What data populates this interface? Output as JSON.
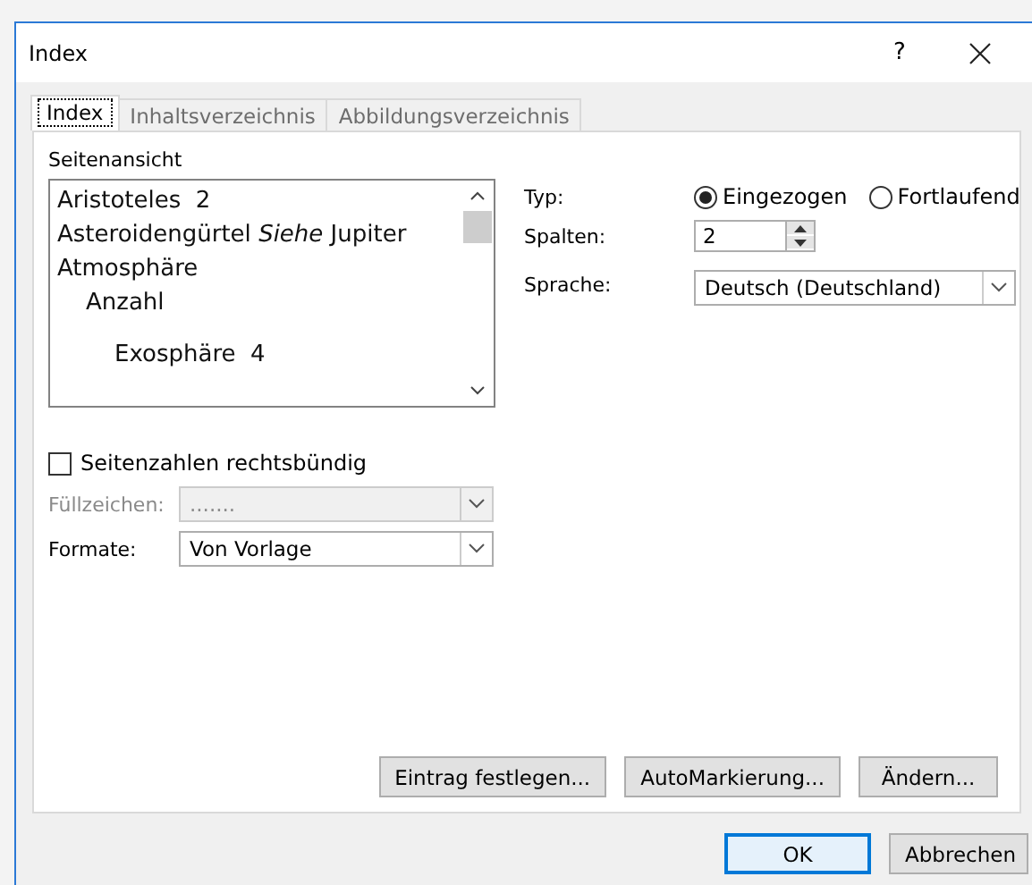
{
  "window": {
    "title": "Index",
    "help_button": "?"
  },
  "tabs": [
    {
      "label": "Index",
      "selected": true
    },
    {
      "label": "Inhaltsverzeichnis",
      "selected": false
    },
    {
      "label": "Abbildungsverzeichnis",
      "selected": false
    }
  ],
  "preview": {
    "label": "Seitenansicht",
    "entries": [
      {
        "text": "Aristoteles  2"
      },
      {
        "text": "Asteroidengürtel *Siehe* Jupiter"
      },
      {
        "text": "Atmosphäre",
        "children": [
          {
            "text": "Anzahl",
            "children": [
              {
                "text": "Exosphäre  4"
              }
            ]
          }
        ]
      }
    ]
  },
  "type": {
    "label": "Typ:",
    "options": [
      {
        "label": "Eingezogen",
        "selected": true
      },
      {
        "label": "Fortlaufend",
        "selected": false
      }
    ]
  },
  "columns": {
    "label": "Spalten:",
    "value": "2"
  },
  "language": {
    "label": "Sprache:",
    "value": "Deutsch (Deutschland)"
  },
  "right_align": {
    "label": "Seitenzahlen rechtsbündig",
    "checked": false
  },
  "leader": {
    "label": "Füllzeichen:",
    "value": ".......",
    "disabled": true
  },
  "formats": {
    "label": "Formate:",
    "value": "Von Vorlage",
    "disabled": false
  },
  "actions": [
    "Eintrag festlegen...",
    "AutoMarkierung...",
    "Ändern..."
  ],
  "buttons": [
    {
      "label": "OK",
      "default": true
    },
    {
      "label": "Abbrechen",
      "default": false
    }
  ]
}
